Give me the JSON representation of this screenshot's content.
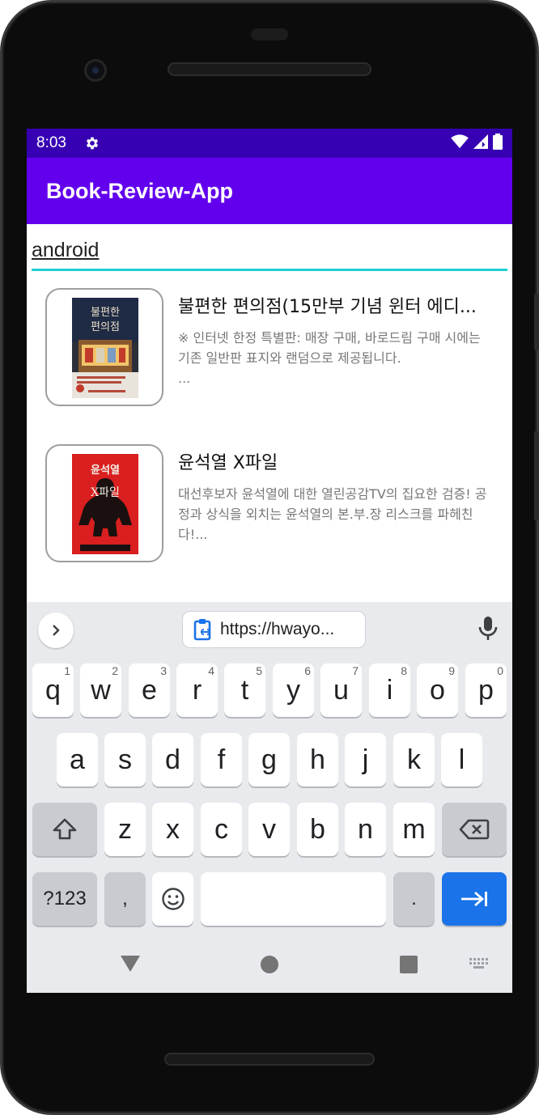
{
  "status_bar": {
    "time": "8:03",
    "icons": [
      "gear-icon",
      "wifi-icon",
      "signal-icon",
      "battery-icon"
    ]
  },
  "app_bar": {
    "title": "Book-Review-App"
  },
  "search": {
    "value": "android"
  },
  "books": [
    {
      "title": "불편한 편의점(15만부 기념 윈터 에디...",
      "description": "※ 인터넷 한정 특별판: 매장 구매, 바로드림 구매 시에는 기존 일반판 표지와 랜덤으로 제공됩니다.",
      "more": "...",
      "cover_text": "불편한 편의점"
    },
    {
      "title": "윤석열 X파일",
      "description": "대선후보자 윤석열에 대한 열린공감TV의 집요한 검증! 공정과 상식을 외치는 윤석열의 본.부.장 리스크를 파헤친다!...",
      "more": "",
      "cover_text": "윤석열 X파일"
    }
  ],
  "keyboard": {
    "clipboard_suggestion": "https://hwayo...",
    "rows": [
      [
        {
          "k": "q",
          "h": "1"
        },
        {
          "k": "w",
          "h": "2"
        },
        {
          "k": "e",
          "h": "3"
        },
        {
          "k": "r",
          "h": "4"
        },
        {
          "k": "t",
          "h": "5"
        },
        {
          "k": "y",
          "h": "6"
        },
        {
          "k": "u",
          "h": "7"
        },
        {
          "k": "i",
          "h": "8"
        },
        {
          "k": "o",
          "h": "9"
        },
        {
          "k": "p",
          "h": "0"
        }
      ],
      [
        {
          "k": "a"
        },
        {
          "k": "s"
        },
        {
          "k": "d"
        },
        {
          "k": "f"
        },
        {
          "k": "g"
        },
        {
          "k": "h"
        },
        {
          "k": "j"
        },
        {
          "k": "k"
        },
        {
          "k": "l"
        }
      ],
      [
        {
          "k": "z"
        },
        {
          "k": "x"
        },
        {
          "k": "c"
        },
        {
          "k": "v"
        },
        {
          "k": "b"
        },
        {
          "k": "n"
        },
        {
          "k": "m"
        }
      ]
    ],
    "symbols_label": "?123",
    "comma_label": ",",
    "period_label": ".",
    "accent_color": "#1a73e8"
  },
  "colors": {
    "status_bar": "#3700b3",
    "app_bar": "#6200ee",
    "search_underline": "#1ed0d0"
  }
}
